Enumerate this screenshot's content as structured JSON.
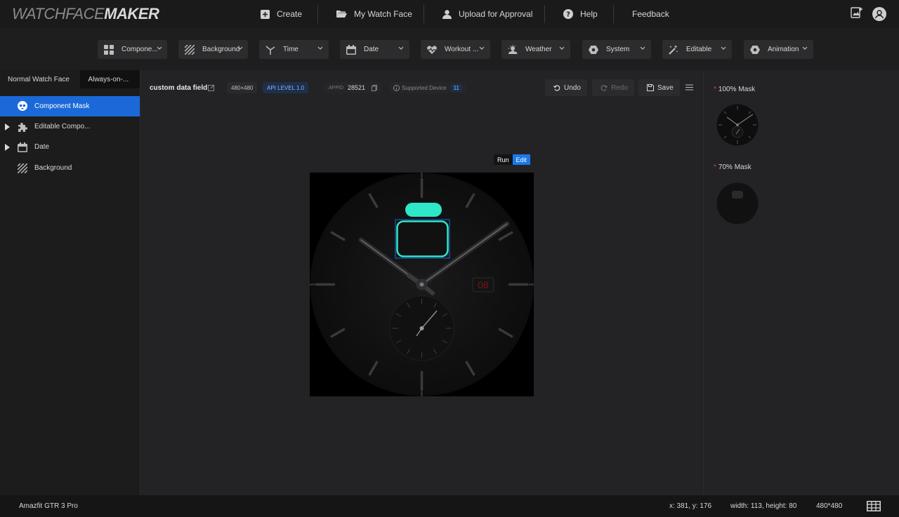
{
  "app": {
    "logo_primary": "WATCHFACE",
    "logo_secondary": "MAKER"
  },
  "topnav": {
    "create": "Create",
    "my_watch_face": "My Watch Face",
    "upload": "Upload for Approval",
    "help": "Help",
    "feedback": "Feedback"
  },
  "toolbar": {
    "component": "Compone...",
    "background": "Background",
    "time": "Time",
    "date": "Date",
    "workout": "Workout ...",
    "weather": "Weather",
    "system": "System",
    "editable": "Editable",
    "animation": "Animation"
  },
  "left": {
    "tab_normal": "Normal Watch Face",
    "tab_aod": "Always-on-...",
    "tree": [
      {
        "label": "Component Mask"
      },
      {
        "label": "Editable Compo..."
      },
      {
        "label": "Date"
      },
      {
        "label": "Background"
      }
    ]
  },
  "info": {
    "name": "custom data field",
    "resolution": "480×480",
    "api_level": "API LEVEL 1.0",
    "appid_label": "APPID",
    "appid": "28521",
    "supported_label": "Supported Device",
    "supported_count": "11",
    "undo": "Undo",
    "redo": "Redo",
    "save": "Save"
  },
  "canvas": {
    "run": "Run",
    "edit": "Edit",
    "date_text": "08"
  },
  "right": {
    "mask100": "100% Mask",
    "mask70": "70% Mask"
  },
  "status": {
    "device": "Amazfit GTR 3 Pro",
    "coords": "x: 381, y: 176",
    "size": "width: 113, height: 80",
    "resolution": "480*480"
  },
  "colors": {
    "accent": "#1b69d9",
    "teal": "#2ee6c8",
    "danger_star": "#e04040"
  }
}
